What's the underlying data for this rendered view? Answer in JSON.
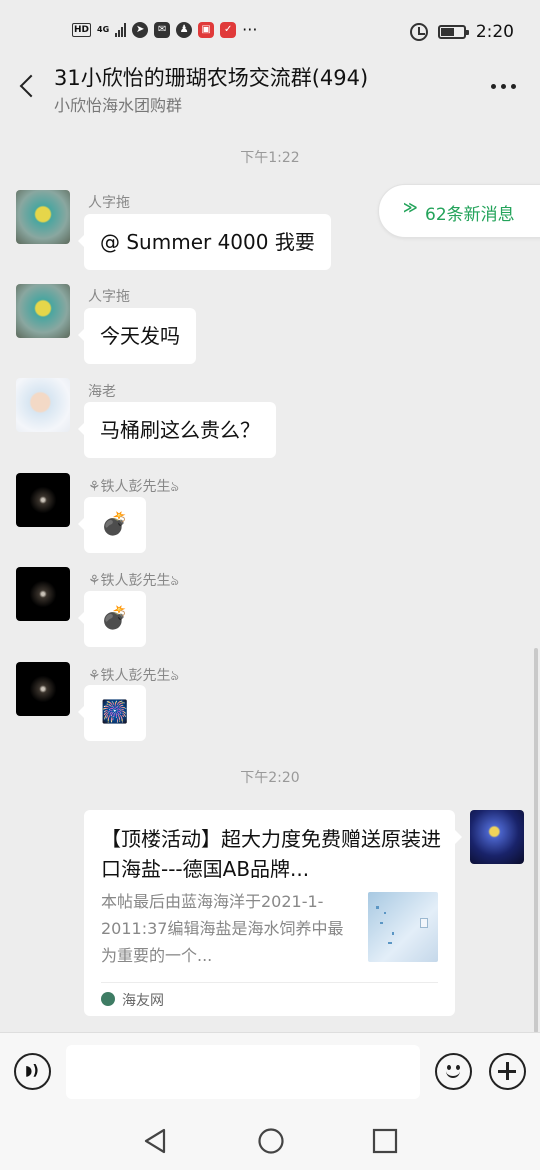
{
  "status_bar": {
    "hd": "HD",
    "network": "4G",
    "time": "2:20",
    "more": "···"
  },
  "header": {
    "title": "31小欣怡的珊瑚农场交流群(494)",
    "subtitle": "小欣怡海水团购群"
  },
  "new_messages": {
    "label": "62条新消息",
    "icon": "double-chevron-up-icon",
    "color": "#23a35a"
  },
  "chat": {
    "timestamps": [
      "下午1:22",
      "下午2:20"
    ],
    "messages": [
      {
        "sender": "人字拖",
        "text": "@ Summer 4000 我要",
        "avatar": "green-creature-avatar"
      },
      {
        "sender": "人字拖",
        "text": "今天发吗",
        "avatar": "green-creature-avatar"
      },
      {
        "sender": "海老",
        "text": "马桶刷这么贵么？",
        "avatar": "cartoon-boy-avatar"
      },
      {
        "sender": "⚘铁人彭先生ঌ",
        "text": "💣",
        "avatar": "dark-wing-avatar"
      },
      {
        "sender": "⚘铁人彭先生ঌ",
        "text": "💣",
        "avatar": "dark-wing-avatar"
      },
      {
        "sender": "⚘铁人彭先生ঌ",
        "text": "🎆",
        "avatar": "dark-wing-avatar"
      }
    ],
    "link_card": {
      "title": "【顶楼活动】超大力度免费赠送原装进口海盐---德国AB品牌...",
      "description": "本帖最后由蓝海海洋于2021-1-2011:37编辑海盐是海水饲养中最为重要的一个...",
      "source": "海友网"
    }
  },
  "colors": {
    "background": "#ededed",
    "bubble": "#ffffff",
    "accent": "#23a35a"
  }
}
